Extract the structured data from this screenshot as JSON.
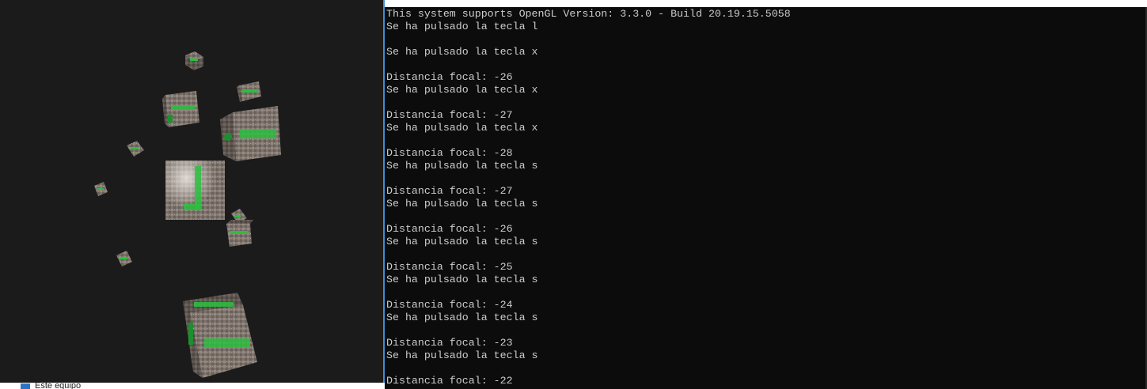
{
  "gl_window": {
    "background": "#1b1b1b",
    "texture_accent": "#2bbf3f",
    "texture_stone": "#8a8078"
  },
  "console": {
    "title": "",
    "foreground": "#cccccc",
    "background": "#0c0c0c",
    "lines": [
      "This system supports OpenGL Version: 3.3.0 - Build 20.19.15.5058",
      "Se ha pulsado la tecla l",
      "",
      "Se ha pulsado la tecla x",
      "",
      "Distancia focal: -26",
      "Se ha pulsado la tecla x",
      "",
      "Distancia focal: -27",
      "Se ha pulsado la tecla x",
      "",
      "Distancia focal: -28",
      "Se ha pulsado la tecla s",
      "",
      "Distancia focal: -27",
      "Se ha pulsado la tecla s",
      "",
      "Distancia focal: -26",
      "Se ha pulsado la tecla s",
      "",
      "Distancia focal: -25",
      "Se ha pulsado la tecla s",
      "",
      "Distancia focal: -24",
      "Se ha pulsado la tecla s",
      "",
      "Distancia focal: -23",
      "Se ha pulsado la tecla s",
      "",
      "Distancia focal: -22"
    ]
  },
  "explorer": {
    "item_label": "Este equipo"
  }
}
